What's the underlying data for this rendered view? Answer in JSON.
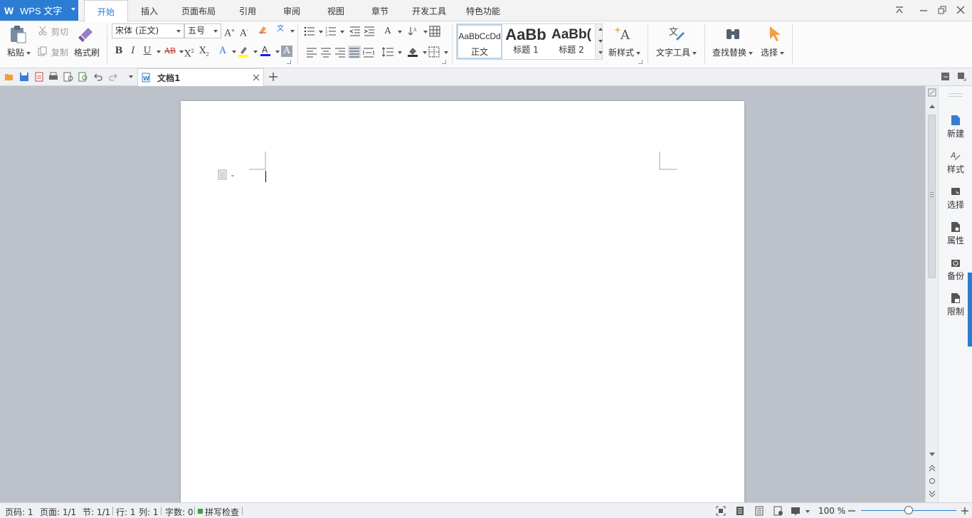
{
  "app": {
    "name": "WPS 文字",
    "logo": "W"
  },
  "tabs": [
    {
      "label": "开始",
      "active": true
    },
    {
      "label": "插入"
    },
    {
      "label": "页面布局"
    },
    {
      "label": "引用"
    },
    {
      "label": "审阅"
    },
    {
      "label": "视图"
    },
    {
      "label": "章节"
    },
    {
      "label": "开发工具"
    },
    {
      "label": "特色功能"
    }
  ],
  "ribbon": {
    "paste": "粘贴",
    "cut": "剪切",
    "copy": "复制",
    "format_painter": "格式刷",
    "font_name": "宋体 (正文)",
    "font_size": "五号",
    "styles": [
      {
        "preview": "AaBbCcDd",
        "label": "正文"
      },
      {
        "preview": "AaBb",
        "label": "标题 1"
      },
      {
        "preview": "AaBb(",
        "label": "标题 2"
      }
    ],
    "new_style": "新样式",
    "text_tools": "文字工具",
    "find_replace": "查找替换",
    "select": "选择"
  },
  "document": {
    "tab_title": "文档1"
  },
  "task_pane": [
    {
      "label": "新建",
      "icon": "new-doc-icon"
    },
    {
      "label": "样式",
      "icon": "style-icon"
    },
    {
      "label": "选择",
      "icon": "select-icon"
    },
    {
      "label": "属性",
      "icon": "properties-icon"
    },
    {
      "label": "备份",
      "icon": "backup-icon"
    },
    {
      "label": "限制",
      "icon": "restrict-icon"
    }
  ],
  "status": {
    "page": "页码: 1",
    "pages": "页面: 1/1",
    "section": "节: 1/1",
    "row": "行: 1",
    "col": "列: 1",
    "words": "字数: 0",
    "spell": "拼写检查",
    "zoom": "100 %",
    "zoom_value": 1.0
  },
  "colors": {
    "accent": "#2b7cd3",
    "highlight": "#ffff00",
    "font_color": "#1a1aff"
  }
}
